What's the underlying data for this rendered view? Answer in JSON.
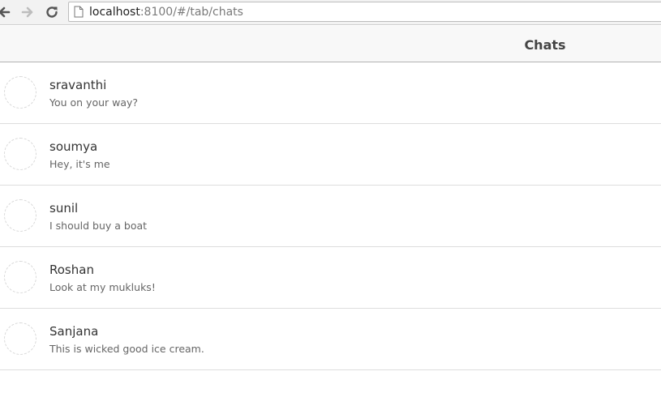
{
  "browser": {
    "url_host": "localhost",
    "url_rest": ":8100/#/tab/chats",
    "icons": {
      "back": "back-arrow-icon",
      "forward": "forward-arrow-icon",
      "reload": "reload-icon",
      "page": "page-icon"
    }
  },
  "header": {
    "title": "Chats"
  },
  "chats": [
    {
      "name": "sravanthi",
      "message": "You on your way?"
    },
    {
      "name": "soumya",
      "message": "Hey, it's me"
    },
    {
      "name": "sunil",
      "message": "I should buy a boat"
    },
    {
      "name": "Roshan",
      "message": "Look at my mukluks!"
    },
    {
      "name": "Sanjana",
      "message": "This is wicked good ice cream."
    }
  ],
  "colors": {
    "header_bg": "#f8f8f8",
    "divider": "#dddddd",
    "text": "#444444"
  }
}
